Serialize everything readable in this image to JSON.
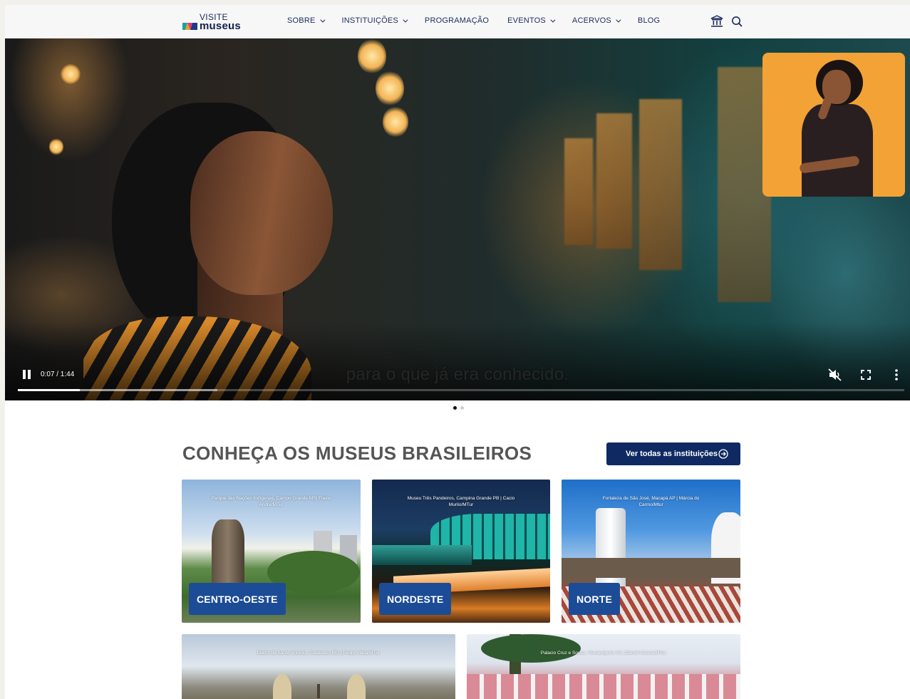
{
  "header": {
    "logo_top": "VISITE",
    "logo_bottom": "museus",
    "nav": [
      {
        "label": "SOBRE",
        "dropdown": true
      },
      {
        "label": "INSTITUIÇÕES",
        "dropdown": true
      },
      {
        "label": "PROGRAMAÇÃO",
        "dropdown": false
      },
      {
        "label": "EVENTOS",
        "dropdown": true
      },
      {
        "label": "ACERVOS",
        "dropdown": true
      },
      {
        "label": "BLOG",
        "dropdown": false
      }
    ],
    "icons": [
      "museum-icon",
      "search-icon"
    ]
  },
  "video": {
    "caption": "para o que já era conhecido.",
    "time": "0:07 / 1:44",
    "played_fraction": 0.07,
    "buffered_fraction": 0.225,
    "muted": true
  },
  "carousel": {
    "slides": 2,
    "active": 0
  },
  "section": {
    "title": "CONHEÇA OS MUSEUS BRASILEIROS",
    "cta_label": "Ver todas as instituições"
  },
  "cards": [
    {
      "region": "CENTRO-OESTE",
      "credit": "Parque das Nações Indígenas, Campo Grande MS| Flavio Andre/MTur"
    },
    {
      "region": "NORDESTE",
      "credit": "Museu Três Pandeiros, Campina Grande PB | Cacio Murilo/MTur"
    },
    {
      "region": "NORTE",
      "credit": "Fortaleza de São José, Macapá AP | Márcia do Carmo/Mtur"
    },
    {
      "region": "",
      "credit": "Matriz de Santo Antônio, Tiradentes MG | Pedro Vilela/MTur"
    },
    {
      "region": "",
      "credit": "Palacio Cruz e Sousa, Florianópolis SC | Daniel Vianna/MTur"
    }
  ],
  "colors": {
    "brand_navy": "#0f2a63",
    "region_badge": "#1d4c96",
    "interpreter_bg": "#f3a235"
  }
}
